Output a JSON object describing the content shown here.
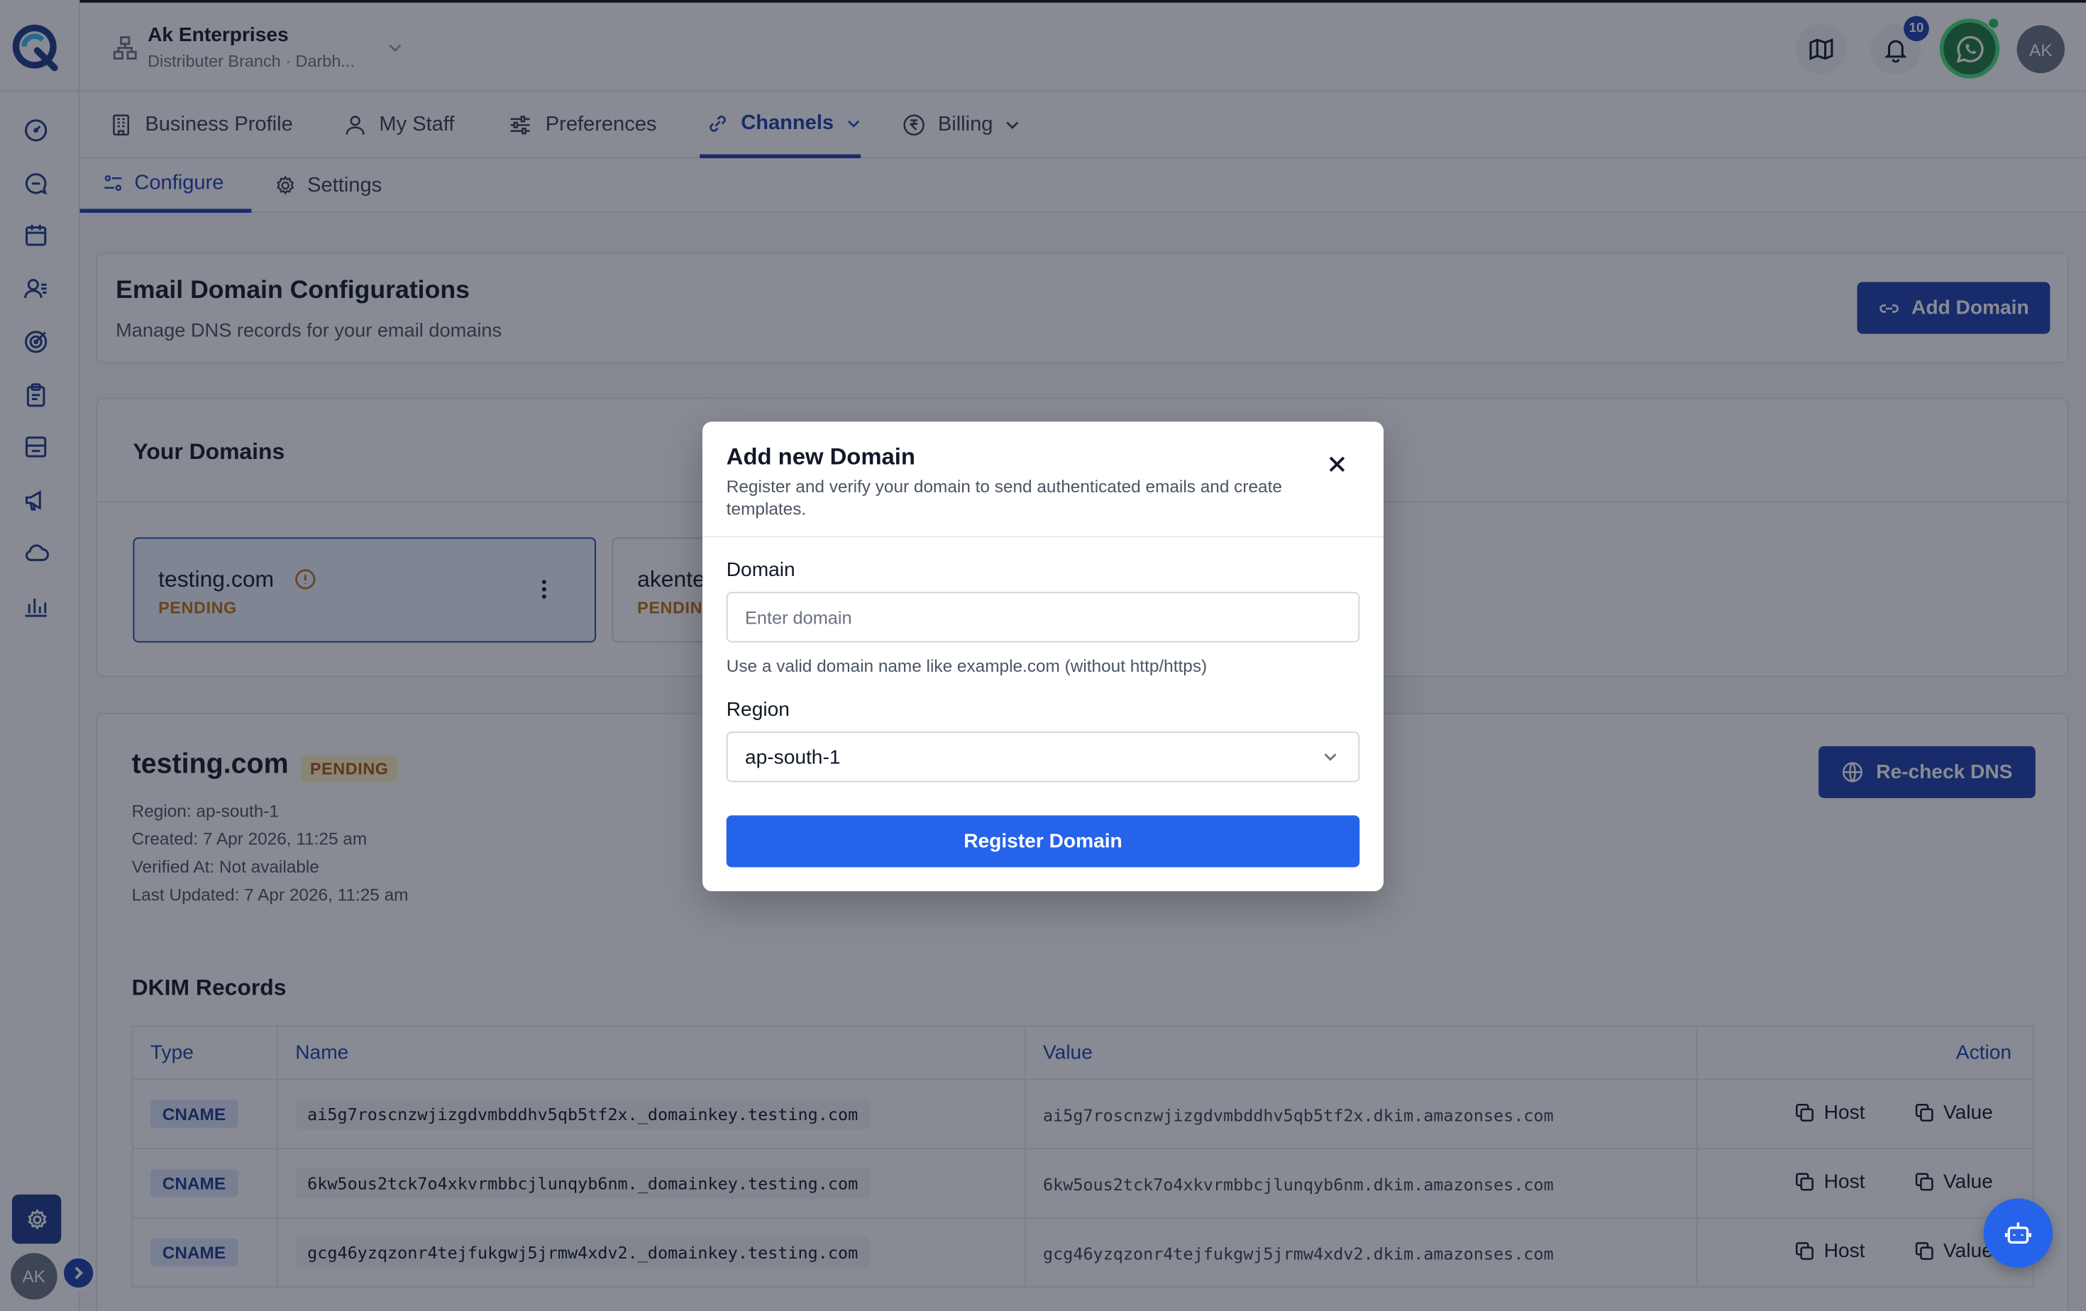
{
  "header": {
    "org_name": "Ak Enterprises",
    "org_sub": "Distributer Branch · Darbh...",
    "notifications_count": "10",
    "avatar_initials": "AK"
  },
  "sidebar": {
    "avatar_initials": "AK",
    "items": [
      "dashboard-icon",
      "chat-icon",
      "calendar-icon",
      "contacts-icon",
      "target-icon",
      "clipboard-icon",
      "inbox-icon",
      "megaphone-icon",
      "cloud-icon",
      "analytics-icon"
    ]
  },
  "tabs": [
    {
      "label": "Business Profile"
    },
    {
      "label": "My Staff"
    },
    {
      "label": "Preferences"
    },
    {
      "label": "Channels"
    },
    {
      "label": "Billing"
    }
  ],
  "subtabs": [
    {
      "label": "Configure"
    },
    {
      "label": "Settings"
    }
  ],
  "page": {
    "title": "Email Domain Configurations",
    "subtitle": "Manage DNS records for your email domains",
    "add_domain_label": "Add Domain"
  },
  "domains": {
    "title": "Your Domains",
    "items": [
      {
        "name": "testing.com",
        "status": "PENDING"
      },
      {
        "name": "akente",
        "status": "PENDIN"
      }
    ]
  },
  "detail": {
    "domain": "testing.com",
    "status": "PENDING",
    "region": "Region: ap-south-1",
    "created": "Created: 7 Apr 2026, 11:25 am",
    "verified": "Verified At: Not available",
    "updated": "Last Updated: 7 Apr 2026, 11:25 am",
    "recheck_label": "Re-check DNS"
  },
  "dkim": {
    "title": "DKIM Records",
    "columns": [
      "Type",
      "Name",
      "Value",
      "Action"
    ],
    "host_label": "Host",
    "value_label": "Value",
    "rows": [
      {
        "type": "CNAME",
        "name": "ai5g7roscnzwjizgdvmbddhv5qb5tf2x._domainkey.testing.com",
        "value": "ai5g7roscnzwjizgdvmbddhv5qb5tf2x.dkim.amazonses.com"
      },
      {
        "type": "CNAME",
        "name": "6kw5ous2tck7o4xkvrmbbcjlunqyb6nm._domainkey.testing.com",
        "value": "6kw5ous2tck7o4xkvrmbbcjlunqyb6nm.dkim.amazonses.com"
      },
      {
        "type": "CNAME",
        "name": "gcg46yzqzonr4tejfukgwj5jrmw4xdv2._domainkey.testing.com",
        "value": "gcg46yzqzonr4tejfukgwj5jrmw4xdv2.dkim.amazonses.com"
      }
    ]
  },
  "modal": {
    "title": "Add new Domain",
    "description": "Register and verify your domain to send authenticated emails and create templates.",
    "domain_label": "Domain",
    "domain_placeholder": "Enter domain",
    "domain_value": "",
    "domain_help": "Use a valid domain name like example.com (without http/https)",
    "region_label": "Region",
    "region_value": "ap-south-1",
    "submit_label": "Register Domain"
  },
  "colors": {
    "primary": "#1e40af",
    "primary_bright": "#2563eb",
    "pending": "#c2700c",
    "whatsapp": "#1f7a3d"
  }
}
